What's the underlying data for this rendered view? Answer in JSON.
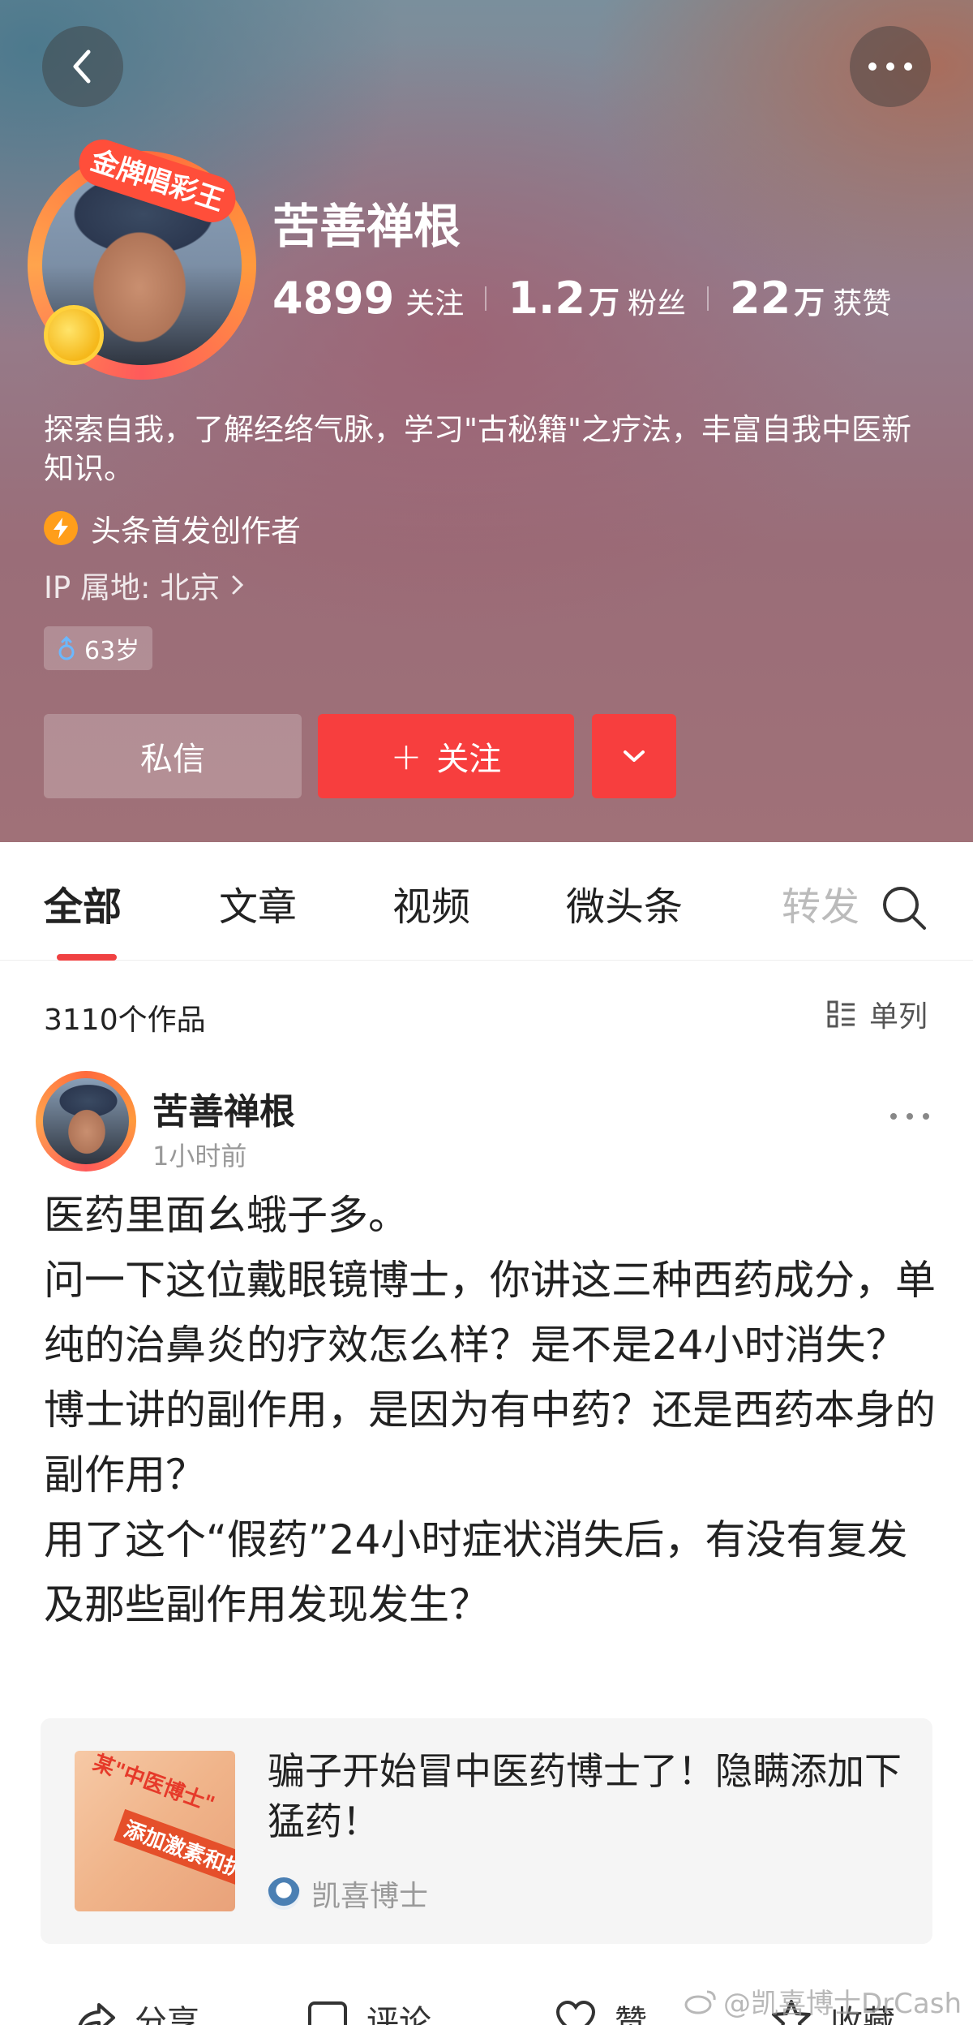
{
  "profile": {
    "name": "苦善禅根",
    "avatar_badge": "金牌唱彩王",
    "stats": [
      {
        "num": "4899",
        "unit": "",
        "label": "关注"
      },
      {
        "num": "1.2",
        "unit": "万",
        "label": "粉丝"
      },
      {
        "num": "22",
        "unit": "万",
        "label": "获赞"
      }
    ],
    "bio": "探索自我，了解经络气脉，学习\"古秘籍\"之疗法，丰富自我中医新知识。",
    "creator_label": "头条首发创作者",
    "ip_label": "IP 属地: 北京",
    "age": "63岁",
    "buttons": {
      "message": "私信",
      "follow_plus": "+",
      "follow": "关注"
    }
  },
  "tabs": [
    {
      "label": "全部",
      "active": true
    },
    {
      "label": "文章",
      "active": false
    },
    {
      "label": "视频",
      "active": false
    },
    {
      "label": "微头条",
      "active": false
    },
    {
      "label": "转发",
      "active": false
    }
  ],
  "works": {
    "count_label": "3110个作品",
    "view_label": "单列"
  },
  "post": {
    "author": "苦善禅根",
    "time": "1小时前",
    "body": [
      "医药里面幺蛾子多。",
      "问一下这位戴眼镜博士，你讲这三种西药成分，单纯的治鼻炎的疗效怎么样？是不是24小时消失？",
      "博士讲的副作用，是因为有中药？还是西药本身的副作用？",
      "用了这个“假药”24小时症状消失后，有没有复发及那些副作用发现发生？"
    ],
    "quote": {
      "title": "骗子开始冒中医药博士了！隐瞒添加下猛药！",
      "author": "凯喜博士",
      "thumb_text_1": "某\"中医博士\"",
      "thumb_text_2": "添加激素和抗"
    }
  },
  "actions": [
    {
      "label": "分享",
      "icon": "share-icon"
    },
    {
      "label": "评论",
      "icon": "comment-icon"
    },
    {
      "label": "赞",
      "icon": "like-icon"
    },
    {
      "label": "收藏",
      "icon": "star-icon"
    }
  ],
  "watermark": "@凯喜博士DrCash",
  "colors": {
    "accent": "#f73e3e",
    "tab_indicator": "#f04142"
  }
}
